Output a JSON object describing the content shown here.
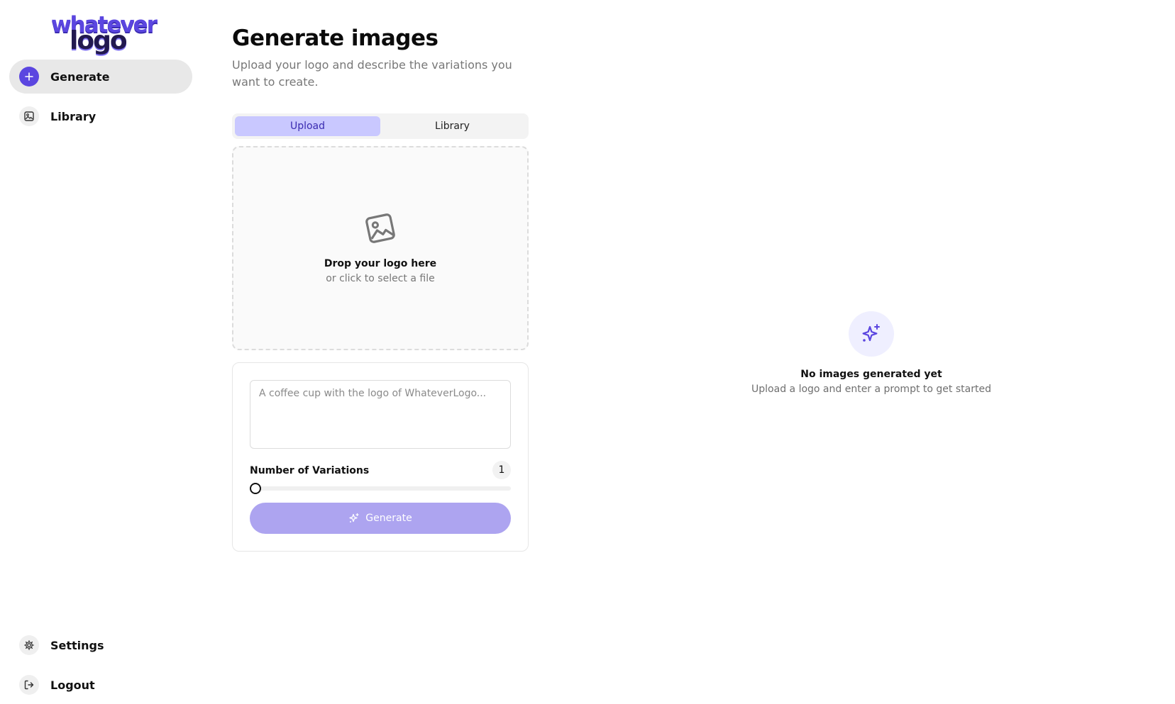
{
  "brand": {
    "logo_top": "whatever",
    "logo_bottom": "logo",
    "accent": "#5b46e0",
    "accent_light": "#ada4f0"
  },
  "sidebar": {
    "items": [
      {
        "label": "Generate",
        "icon": "plus-icon",
        "active": true
      },
      {
        "label": "Library",
        "icon": "image-icon",
        "active": false
      }
    ],
    "bottom_items": [
      {
        "label": "Settings",
        "icon": "gear-icon"
      },
      {
        "label": "Logout",
        "icon": "logout-icon"
      }
    ]
  },
  "main": {
    "title": "Generate images",
    "subtitle": "Upload your logo and describe the variations you want to create.",
    "tabs": [
      {
        "label": "Upload",
        "active": true
      },
      {
        "label": "Library",
        "active": false
      }
    ],
    "dropzone": {
      "title": "Drop your logo here",
      "subtitle": "or click to select a file",
      "icon": "image-icon"
    },
    "form": {
      "prompt_placeholder": "A coffee cup with the logo of WhateverLogo...",
      "prompt_value": "",
      "variations_label": "Number of Variations",
      "variations_value": "1",
      "generate_label": "Generate",
      "generate_icon": "sparkles-icon"
    }
  },
  "empty_state": {
    "icon": "sparkles-icon",
    "title": "No images generated yet",
    "subtitle": "Upload a logo and enter a prompt to get started"
  }
}
